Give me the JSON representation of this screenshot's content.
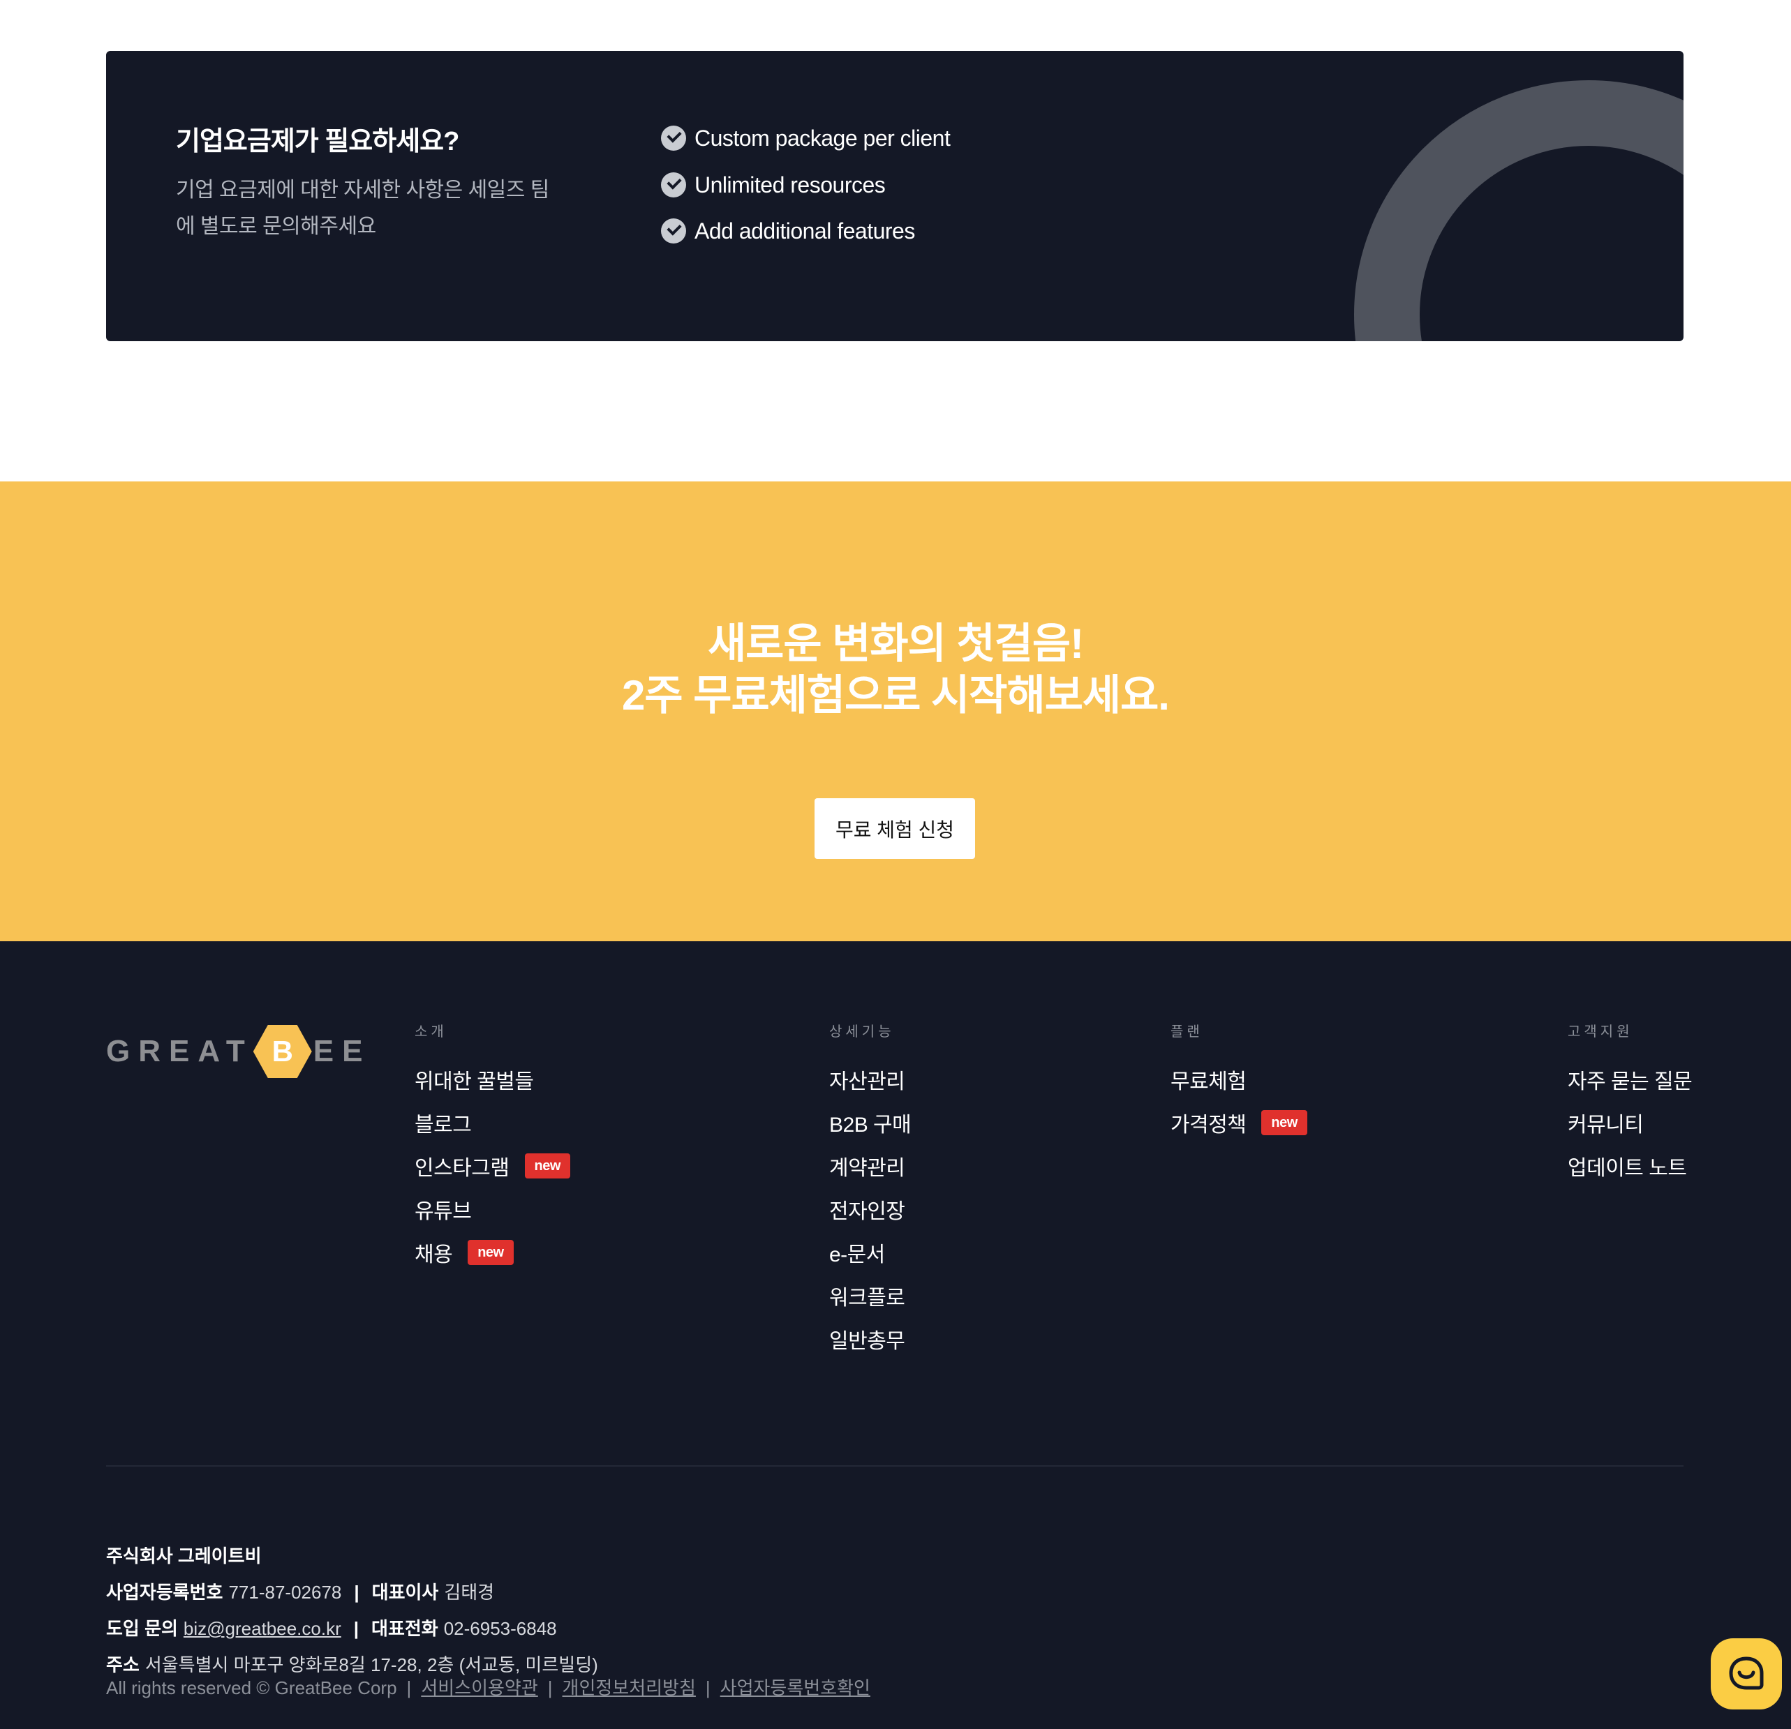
{
  "enterprise": {
    "title": "기업요금제가 필요하세요?",
    "description": "기업 요금제에 대한 자세한 사항은 세일즈 팀에 별도로 문의해주세요",
    "features": [
      "Custom package per client",
      "Unlimited resources",
      "Add additional features"
    ]
  },
  "cta": {
    "title_line1": "새로운 변화의 첫걸음!",
    "title_line2": "2주 무료체험으로 시작해보세요.",
    "button_label": "무료 체험 신청"
  },
  "footer": {
    "logo": {
      "left": "GREAT",
      "mark": "B",
      "right": "EE"
    },
    "columns": [
      {
        "heading": "소개",
        "links": [
          {
            "label": "위대한 꿀벌들",
            "badge": ""
          },
          {
            "label": "블로그",
            "badge": ""
          },
          {
            "label": "인스타그램",
            "badge": "new"
          },
          {
            "label": "유튜브",
            "badge": ""
          },
          {
            "label": "채용",
            "badge": "new"
          }
        ]
      },
      {
        "heading": "상세기능",
        "links": [
          {
            "label": "자산관리",
            "badge": ""
          },
          {
            "label": "B2B 구매",
            "badge": ""
          },
          {
            "label": "계약관리",
            "badge": ""
          },
          {
            "label": "전자인장",
            "badge": ""
          },
          {
            "label": "e-문서",
            "badge": ""
          },
          {
            "label": "워크플로",
            "badge": ""
          },
          {
            "label": "일반총무",
            "badge": ""
          }
        ]
      },
      {
        "heading": "플랜",
        "links": [
          {
            "label": "무료체험",
            "badge": ""
          },
          {
            "label": "가격정책",
            "badge": "new"
          }
        ]
      },
      {
        "heading": "고객지원",
        "links": [
          {
            "label": "자주 묻는 질문",
            "badge": ""
          },
          {
            "label": "커뮤니티",
            "badge": ""
          },
          {
            "label": "업데이트 노트",
            "badge": ""
          }
        ]
      }
    ],
    "company": {
      "name": "주식회사 그레이트비",
      "reg_label": "사업자등록번호",
      "reg_value": "771-87-02678",
      "ceo_label": "대표이사",
      "ceo_value": "김태경",
      "inquiry_label": "도입 문의",
      "inquiry_value": "biz@greatbee.co.kr",
      "phone_label": "대표전화",
      "phone_value": "02-6953-6848",
      "address_label": "주소",
      "address_value": "서울특별시 마포구 양화로8길 17-28, 2층 (서교동, 미르빌딩)",
      "separator": "|"
    },
    "copyright": {
      "text": "All rights reserved © GreatBee Corp",
      "separator": "|",
      "links": [
        "서비스이용약관",
        "개인정보처리방침",
        "사업자등록번호확인"
      ]
    }
  },
  "colors": {
    "dark": "#141826",
    "yellow": "#f8c254",
    "badge": "#e0312d",
    "chat": "#fbcd44"
  },
  "icons": {
    "check": "check-circle-icon",
    "chat": "chat-bubble-icon"
  }
}
